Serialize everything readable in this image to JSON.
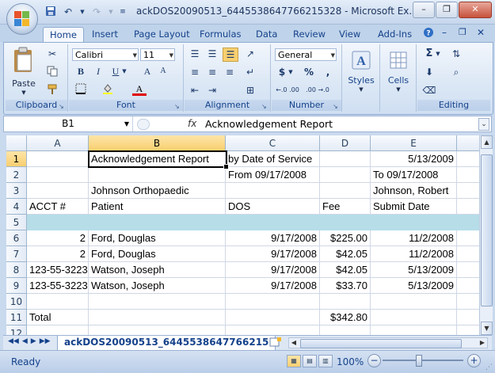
{
  "window": {
    "title": "ackDOS20090513_6445538647766215328 - Microsoft Ex...",
    "controls": {
      "minimize": "–",
      "restore": "❐",
      "close": "✕"
    }
  },
  "qat": {
    "save_icon": "save-icon",
    "undo_icon": "undo-icon",
    "redo_icon": "redo-icon"
  },
  "ribbon": {
    "tabs": [
      "Home",
      "Insert",
      "Page Layout",
      "Formulas",
      "Data",
      "Review",
      "View",
      "Add-Ins"
    ],
    "active_tab": "Home",
    "groups": {
      "clipboard": {
        "label": "Clipboard",
        "paste": "Paste"
      },
      "font": {
        "label": "Font",
        "name": "Calibri",
        "size": "11",
        "bold": "B",
        "italic": "I",
        "underline": "U",
        "grow": "A",
        "shrink": "A",
        "color_letter": "A"
      },
      "alignment": {
        "label": "Alignment"
      },
      "number": {
        "label": "Number",
        "format": "General",
        "currency": "$",
        "percent": "%",
        "comma": ",",
        "inc_decimal": "←.0 .00",
        "dec_decimal": ".00 →.0"
      },
      "styles": {
        "label": "Styles"
      },
      "cells": {
        "label": "Cells"
      },
      "editing": {
        "label": "Editing",
        "sum": "Σ"
      }
    },
    "help_icon": "help-icon"
  },
  "formula_bar": {
    "name_box": "B1",
    "fx": "fx",
    "content": "Acknowledgement Report"
  },
  "columns": [
    "A",
    "B",
    "C",
    "D",
    "E"
  ],
  "rows": [
    "1",
    "2",
    "3",
    "4",
    "5",
    "6",
    "7",
    "8",
    "9",
    "10",
    "11",
    "12"
  ],
  "cells": {
    "r1": {
      "B": "Acknowledgement Report",
      "C": "by Date of Service",
      "E": "5/13/2009"
    },
    "r2": {
      "C": "From 09/17/2008",
      "E": "To 09/17/2008"
    },
    "r3": {
      "B": "Johnson Orthopaedic",
      "E": "Johnson, Robert"
    },
    "r4": {
      "A": "ACCT #",
      "B": "Patient",
      "C": "DOS",
      "D": "Fee",
      "E": "Submit Date"
    },
    "r6": {
      "A": "2",
      "B": "Ford, Douglas",
      "C": "9/17/2008",
      "D": "$225.00",
      "E": "11/2/2008"
    },
    "r7": {
      "A": "2",
      "B": "Ford, Douglas",
      "C": "9/17/2008",
      "D": "$42.05",
      "E": "11/2/2008"
    },
    "r8": {
      "A": "123-55-3223",
      "B": "Watson, Joseph",
      "C": "9/17/2008",
      "D": "$42.05",
      "E": "5/13/2009"
    },
    "r9": {
      "A": "123-55-3223",
      "B": "Watson, Joseph",
      "C": "9/17/2008",
      "D": "$33.70",
      "E": "5/13/2009"
    },
    "r11": {
      "A": "Total",
      "D": "$342.80"
    }
  },
  "colors": {
    "band": "#b6dde8",
    "selection_header": "#f8cf6f"
  },
  "sheet": {
    "tab_name": "ackDOS20090513_6445538647766215"
  },
  "status": {
    "text": "Ready",
    "zoom": "100%"
  }
}
